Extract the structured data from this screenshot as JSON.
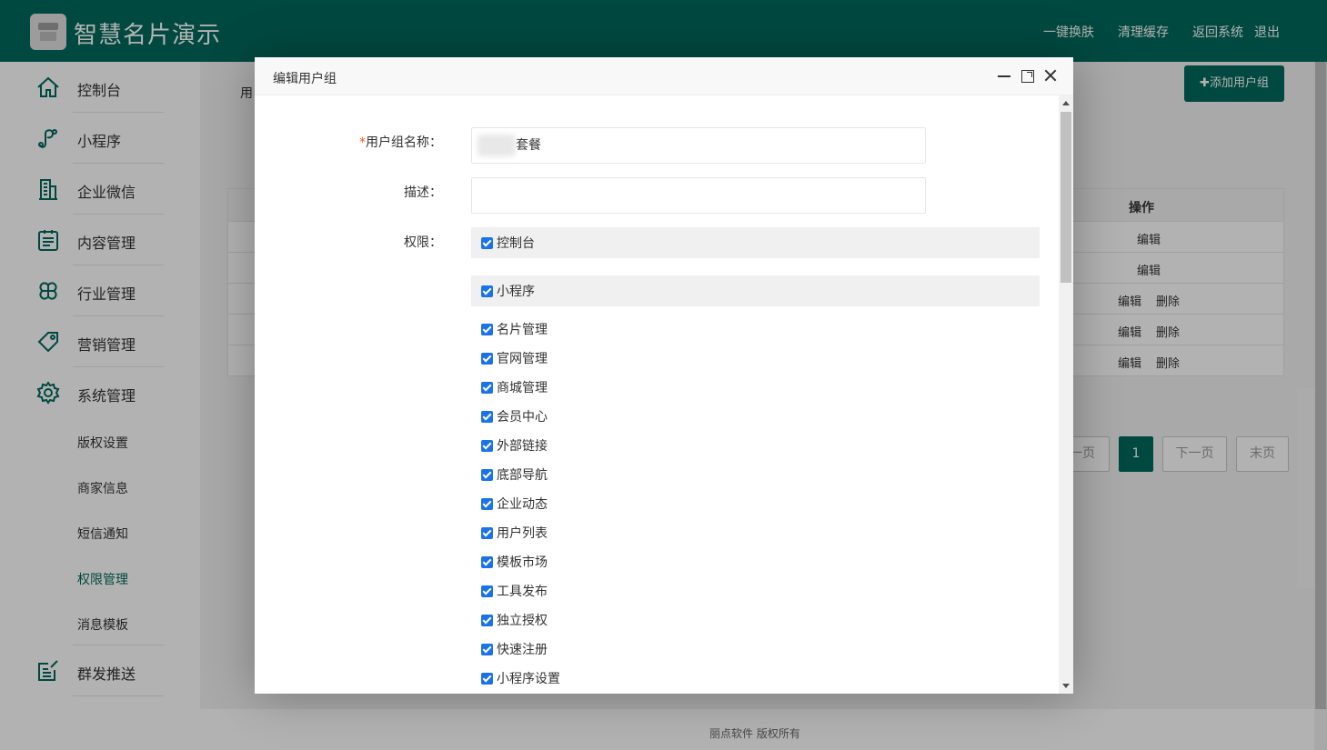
{
  "header": {
    "brand": "智慧名片演示",
    "nav": [
      "一键换肤",
      "清理缓存",
      "返回系统",
      "退出"
    ]
  },
  "sidebar": {
    "items": [
      {
        "label": "控制台",
        "icon": "home-icon"
      },
      {
        "label": "小程序",
        "icon": "miniprogram-icon"
      },
      {
        "label": "企业微信",
        "icon": "building-icon"
      },
      {
        "label": "内容管理",
        "icon": "clipboard-icon"
      },
      {
        "label": "行业管理",
        "icon": "clover-icon"
      },
      {
        "label": "营销管理",
        "icon": "tag-icon"
      },
      {
        "label": "系统管理",
        "icon": "gear-icon"
      }
    ],
    "sub_items": [
      "版权设置",
      "商家信息",
      "短信通知",
      "权限管理",
      "消息模板"
    ],
    "last_item": {
      "label": "群发推送",
      "icon": "edit-doc-icon"
    }
  },
  "background": {
    "tab_stub": "用",
    "add_button": "✚添加用户组",
    "table_header_op": "操作",
    "rows": [
      {
        "actions": [
          "编辑"
        ]
      },
      {
        "actions": [
          "编辑"
        ]
      },
      {
        "actions": [
          "编辑",
          "删除"
        ]
      },
      {
        "actions": [
          "编辑",
          "删除"
        ]
      },
      {
        "actions": [
          "编辑",
          "删除"
        ]
      }
    ],
    "pager": {
      "prev": "一页",
      "current": "1",
      "next": "下一页",
      "last": "末页"
    },
    "footer": "丽点软件 版权所有"
  },
  "dialog": {
    "title": "编辑用户组",
    "fields": {
      "name_required_mark": "*",
      "name_label": "用户组名称：",
      "name_value": "套餐",
      "desc_label": "描述：",
      "desc_value": "",
      "perm_label": "权限："
    },
    "groups": [
      {
        "label": "控制台",
        "checked": true
      },
      {
        "label": "小程序",
        "checked": true
      }
    ],
    "permissions": [
      {
        "label": "名片管理",
        "checked": true
      },
      {
        "label": "官网管理",
        "checked": true
      },
      {
        "label": "商城管理",
        "checked": true
      },
      {
        "label": "会员中心",
        "checked": true
      },
      {
        "label": "外部链接",
        "checked": true
      },
      {
        "label": "底部导航",
        "checked": true
      },
      {
        "label": "企业动态",
        "checked": true
      },
      {
        "label": "用户列表",
        "checked": true
      },
      {
        "label": "模板市场",
        "checked": true
      },
      {
        "label": "工具发布",
        "checked": true
      },
      {
        "label": "独立授权",
        "checked": true
      },
      {
        "label": "快速注册",
        "checked": true
      },
      {
        "label": "小程序设置",
        "checked": true
      }
    ]
  },
  "colors": {
    "primary": "#00695c",
    "checkbox": "#1a73e8",
    "required": "#ff5722"
  }
}
